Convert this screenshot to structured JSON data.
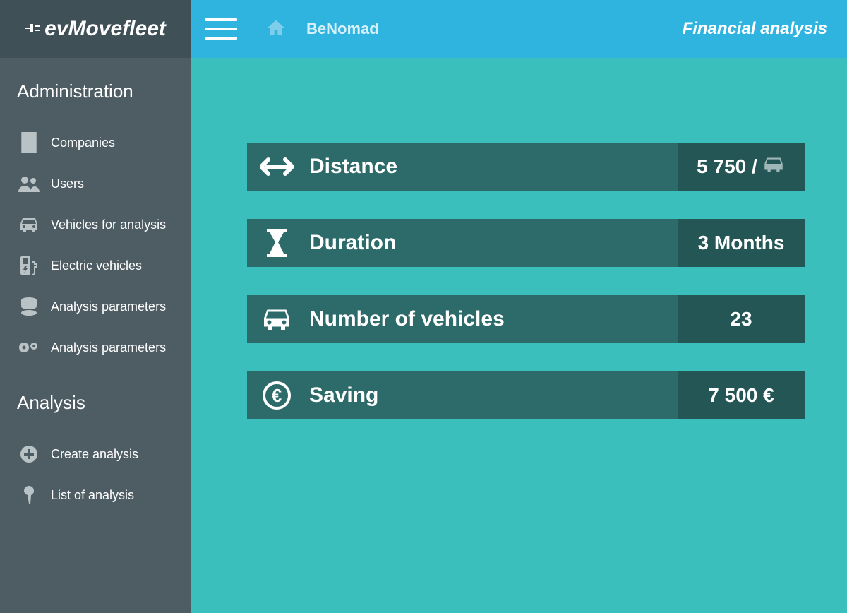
{
  "logo": "evMovefleet",
  "breadcrumb": "BeNomad",
  "page_title": "Financial analysis",
  "sidebar": {
    "sections": [
      {
        "title": "Administration",
        "items": [
          {
            "label": "Companies",
            "icon": "building-icon"
          },
          {
            "label": "Users",
            "icon": "users-icon"
          },
          {
            "label": "Vehicles for analysis",
            "icon": "car-icon"
          },
          {
            "label": "Electric vehicles",
            "icon": "charger-icon"
          },
          {
            "label": "Analysis parameters",
            "icon": "database-icon"
          },
          {
            "label": "Analysis parameters",
            "icon": "gears-icon"
          }
        ]
      },
      {
        "title": "Analysis",
        "items": [
          {
            "label": "Create analysis",
            "icon": "plus-circle-icon"
          },
          {
            "label": "List of analysis",
            "icon": "pin-icon"
          }
        ]
      }
    ]
  },
  "stats": [
    {
      "icon": "distance-icon",
      "label": "Distance",
      "value": "5 750 /",
      "trailing_icon": "car-small-icon"
    },
    {
      "icon": "hourglass-icon",
      "label": "Duration",
      "value": "3 Months"
    },
    {
      "icon": "car-icon",
      "label": "Number of vehicles",
      "value": "23"
    },
    {
      "icon": "euro-icon",
      "label": "Saving",
      "value": "7 500 €"
    }
  ]
}
